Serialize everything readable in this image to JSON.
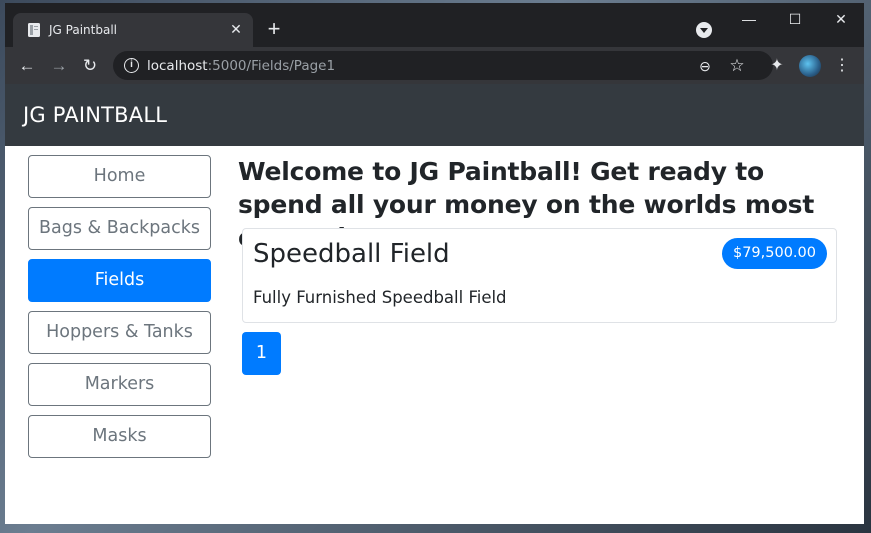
{
  "browser": {
    "tab_title": "JG Paintball",
    "tab_close": "✕",
    "new_tab": "+",
    "url_host": "localhost",
    "url_path": ":5000/Fields/Page1",
    "minimize": "—",
    "maximize": "☐",
    "close": "✕",
    "back": "←",
    "forward": "→",
    "reload": "↻",
    "info": "i",
    "zoom": "⊖",
    "bookmark": "☆",
    "extensions": "✦",
    "menu": "⋮"
  },
  "site": {
    "brand": "JG PAINTBALL",
    "categories": [
      {
        "label": "Home",
        "active": false
      },
      {
        "label": "Bags & Backpacks",
        "active": false
      },
      {
        "label": "Fields",
        "active": true
      },
      {
        "label": "Hoppers & Tanks",
        "active": false
      },
      {
        "label": "Markers",
        "active": false
      },
      {
        "label": "Masks",
        "active": false
      }
    ],
    "welcome": "Welcome to JG Paintball! Get ready to spend all your money on the worlds most expensive sport!",
    "products": [
      {
        "name": "Speedball Field",
        "price": "$79,500.00",
        "description": "Fully Furnished Speedball Field"
      }
    ],
    "pagination": [
      "1"
    ]
  },
  "colors": {
    "primary": "#007bff",
    "navbar": "#343a40",
    "outline": "#6c757d"
  }
}
